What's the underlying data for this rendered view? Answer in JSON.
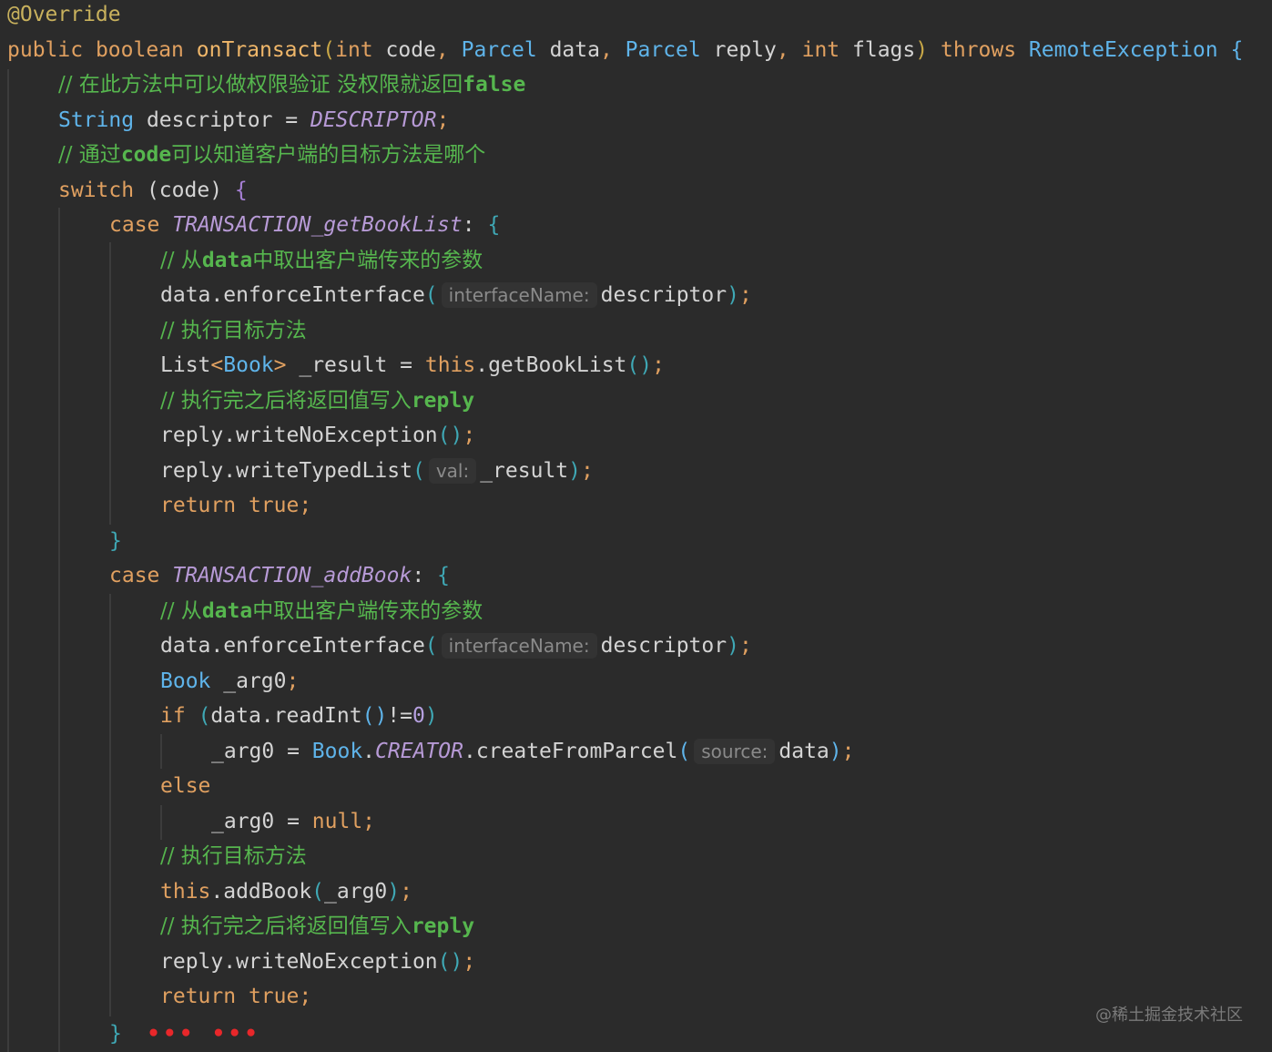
{
  "code": {
    "l1": {
      "anno": "@Override"
    },
    "l2": {
      "public": "public",
      "boolean": "boolean",
      "name": "onTransact",
      "lp": "(",
      "int1": "int",
      "code": "code",
      "c1": ",",
      "parcel1": "Parcel",
      "data": "data",
      "c2": ",",
      "parcel2": "Parcel",
      "reply": "reply",
      "c3": ",",
      "int2": "int",
      "flags": "flags",
      "rp": ")",
      "throws": "throws",
      "exc": "RemoteException",
      "lb": "{"
    },
    "l3": {
      "comment_a": "// 在此方法中可以做权限验证 没权限就返回",
      "comment_b": "false"
    },
    "l4": {
      "type": "String",
      "rest": "descriptor = ",
      "const": "DESCRIPTOR",
      "semi": ";"
    },
    "l5": {
      "comment_a": "// 通过",
      "comment_b": "code",
      "comment_c": "可以知道客户端的目标方法是哪个"
    },
    "l6": {
      "switch": "switch",
      "rest": "(code)",
      "lb": "{"
    },
    "l7": {
      "case": "case",
      "const": "TRANSACTION_getBookList",
      "colon": ":",
      "lb": "{"
    },
    "l8": {
      "comment_a": "// 从",
      "comment_b": "data",
      "comment_c": "中取出客户端传来的参数"
    },
    "l9": {
      "call": "data.enforceInterface",
      "lp": "(",
      "hint": "interfaceName:",
      "arg": "descriptor",
      "rp": ")",
      "semi": ";"
    },
    "l10": {
      "comment": "// 执行目标方法"
    },
    "l11": {
      "list": "List",
      "lt": "<",
      "book": "Book",
      "gt": ">",
      "rest": "_result = ",
      "this": "this",
      "call": ".getBookList",
      "parens": "()",
      "semi": ";"
    },
    "l12": {
      "comment_a": "// 执行完之后将返回值写入",
      "comment_b": "reply"
    },
    "l13": {
      "call": "reply.writeNoException",
      "parens": "()",
      "semi": ";"
    },
    "l14": {
      "call": "reply.writeTypedList",
      "lp": "(",
      "hint": "val:",
      "arg": "_result",
      "rp": ")",
      "semi": ";"
    },
    "l15": {
      "return": "return",
      "true": "true",
      "semi": ";"
    },
    "l16": {
      "rb": "}"
    },
    "l17": {
      "case": "case",
      "const": "TRANSACTION_addBook",
      "colon": ":",
      "lb": "{"
    },
    "l18": {
      "comment_a": "// 从",
      "comment_b": "data",
      "comment_c": "中取出客户端传来的参数"
    },
    "l19": {
      "call": "data.enforceInterface",
      "lp": "(",
      "hint": "interfaceName:",
      "arg": "descriptor",
      "rp": ")",
      "semi": ";"
    },
    "l20": {
      "book": "Book",
      "rest": "_arg0",
      "semi": ";"
    },
    "l21": {
      "if": "if",
      "lp": "(",
      "call": "data.readInt",
      "parens": "()",
      "neq": "!=",
      "zero": "0",
      "rp": ")"
    },
    "l22": {
      "lhs": "_arg0 = ",
      "book": "Book",
      "dot": ".",
      "const": "CREATOR",
      "call": ".createFromParcel",
      "lp": "(",
      "hint": "source:",
      "arg": "data",
      "rp": ")",
      "semi": ";"
    },
    "l23": {
      "else": "else"
    },
    "l24": {
      "lhs": "_arg0 = ",
      "null": "null",
      "semi": ";"
    },
    "l25": {
      "comment": "// 执行目标方法"
    },
    "l26": {
      "this": "this",
      "call": ".addBook",
      "lp": "(",
      "arg": "_arg0",
      "rp": ")",
      "semi": ";"
    },
    "l27": {
      "comment_a": "// 执行完之后将返回值写入",
      "comment_b": "reply"
    },
    "l28": {
      "call": "reply.writeNoException",
      "parens": "()",
      "semi": ";"
    },
    "l29": {
      "return": "return",
      "true": "true",
      "semi": ";"
    },
    "l30": {
      "rb": "}",
      "dots": "••• •••"
    }
  },
  "watermark": "@稀土掘金技术社区",
  "colors": {
    "background": "#2b2b2b",
    "keyword": "#e0a060",
    "type": "#5fb4ea",
    "comment": "#56b64e",
    "constant": "#b79ad6",
    "ellipsis": "#e8272a"
  }
}
